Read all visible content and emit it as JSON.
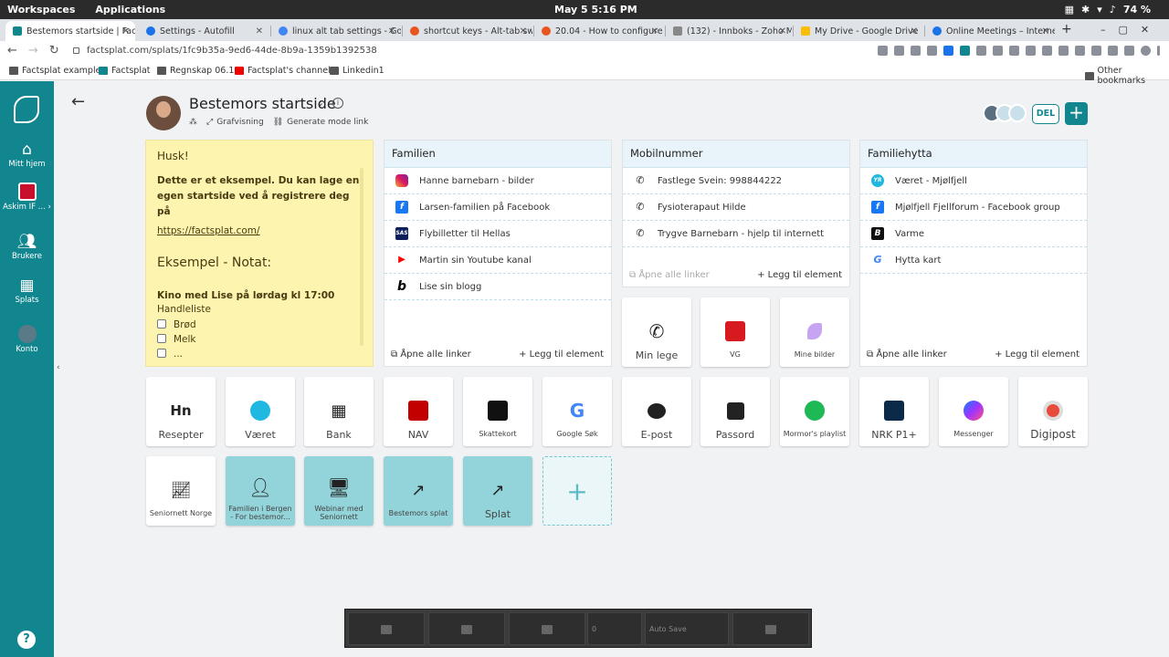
{
  "system": {
    "workspaces": "Workspaces",
    "applications": "Applications",
    "datetime": "May 5   5:16 PM",
    "battery": "74 %"
  },
  "tabs": [
    {
      "title": "Bestemors startside | Fac",
      "color": "#12868f"
    },
    {
      "title": "Settings - Autofill",
      "color": "#1a73e8"
    },
    {
      "title": "linux alt tab settings - Go",
      "color": "#4285f4"
    },
    {
      "title": "shortcut keys - Alt-tab sw",
      "color": "#e95420"
    },
    {
      "title": "20.04 - How to configure A",
      "color": "#e95420"
    },
    {
      "title": "(132) - Innboks - Zoho Ma",
      "color": "#888888"
    },
    {
      "title": "My Drive - Google Drive",
      "color": "#fbbc04"
    },
    {
      "title": "Online Meetings – Interne",
      "color": "#1a73e8"
    }
  ],
  "address": {
    "url": "factsplat.com/splats/1fc9b35a-9ed6-44de-8b9a-1359b1392538"
  },
  "bookmarks": [
    "Factsplat example",
    "Factsplat",
    "Regnskap 06.10",
    "Factsplat's channel",
    "Linkedin1",
    "Other bookmarks"
  ],
  "sidebar": {
    "items": [
      "Mitt hjem",
      "Askim IF ...",
      "Brukere",
      "Splats",
      "Konto"
    ],
    "help": "?"
  },
  "header": {
    "title": "Bestemors startside",
    "grafvisning": "Grafvisning",
    "generate": "Generate mode link",
    "del": "DEL",
    "plus": "+"
  },
  "note": {
    "title": "Husk!",
    "body": "Dette er et eksempel. Du kan lage en egen startside ved å registrere deg på",
    "link": "https://factsplat.com/",
    "heading": "Eksempel - Notat:",
    "bold": "Kino med Lise på lørdag kl 17:00",
    "list_title": "Handleliste",
    "items": [
      "Brød",
      "Melk",
      "..."
    ]
  },
  "cards": [
    {
      "title": "Familien",
      "rows": [
        "Hanne barnebarn - bilder",
        "Larsen-familien på Facebook",
        "Flybilletter til Hellas",
        "Martin sin Youtube kanal",
        "Lise sin blogg"
      ],
      "open": "Åpne alle linker",
      "add": "Legg til element"
    },
    {
      "title": "Mobilnummer",
      "rows": [
        "Fastlege Svein: 998844222",
        "Fysioterapaut Hilde",
        "Trygve Barnebarn - hjelp til internett"
      ],
      "open": "Åpne alle linker",
      "add": "Legg til element"
    },
    {
      "title": "Familiehytta",
      "rows": [
        "Været - Mjølfjell",
        "Mjølfjell Fjellforum - Facebook group",
        "Varme",
        "Hytta kart"
      ],
      "open": "Åpne alle linker",
      "add": "Legg til element"
    }
  ],
  "tiles_row1": [
    "Min lege",
    "VG",
    "Mine bilder"
  ],
  "tiles_row2": [
    "Resepter",
    "Været",
    "Bank",
    "NAV",
    "Skattekort",
    "Google Søk",
    "E-post",
    "Passord",
    "Mormor's playlist",
    "NRK P1+",
    "Messenger",
    "Digipost"
  ],
  "tiles_row3": [
    "Seniornett Norge",
    "Familien i Bergen - For bestemor...",
    "Webinar med Seniornett",
    "Bestemors splat",
    "Splat"
  ],
  "bottom": {
    "value": "0",
    "autosave": "Auto Save"
  },
  "colors": {
    "brand": "#12868f",
    "note": "#fdf4b0",
    "card_header": "#e8f4f9",
    "teal_tile": "#93d4da"
  }
}
